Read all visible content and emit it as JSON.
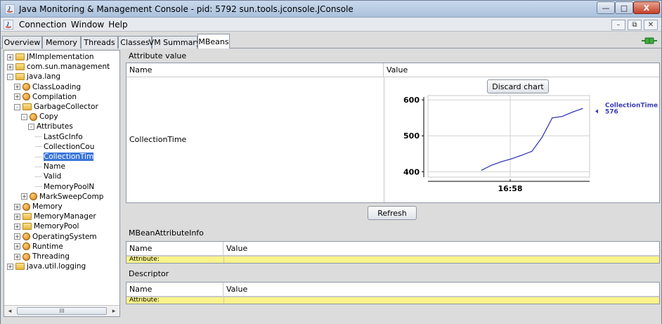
{
  "window": {
    "title": "Java Monitoring & Management Console - pid: 5792 sun.tools.jconsole.JConsole",
    "controls": {
      "minimize": "—",
      "maximize": "□",
      "close": "X"
    }
  },
  "menu": {
    "items": [
      "Connection",
      "Window",
      "Help"
    ],
    "mdi": {
      "minimize": "–",
      "restore": "⧉",
      "close": "✕"
    }
  },
  "tabs": [
    {
      "label": "Overview",
      "active": false
    },
    {
      "label": "Memory",
      "active": false
    },
    {
      "label": "Threads",
      "active": false
    },
    {
      "label": "Classes",
      "active": false
    },
    {
      "label": "VM Summary",
      "active": false
    },
    {
      "label": "MBeans",
      "active": true
    }
  ],
  "tree": {
    "nodes": [
      {
        "label": "JMImplementation",
        "icon": "folder",
        "expander": "+",
        "depth": 0
      },
      {
        "label": "com.sun.management",
        "icon": "folder",
        "expander": "+",
        "depth": 0
      },
      {
        "label": "java.lang",
        "icon": "folder",
        "expander": "-",
        "depth": 0
      },
      {
        "label": "ClassLoading",
        "icon": "bean",
        "expander": "+",
        "depth": 1
      },
      {
        "label": "Compilation",
        "icon": "bean",
        "expander": "+",
        "depth": 1
      },
      {
        "label": "GarbageCollector",
        "icon": "folder",
        "expander": "-",
        "depth": 1
      },
      {
        "label": "Copy",
        "icon": "bean",
        "expander": "-",
        "depth": 2
      },
      {
        "label": "Attributes",
        "icon": "none",
        "expander": "-",
        "depth": 3
      },
      {
        "label": "LastGcInfo",
        "icon": "none",
        "expander": "",
        "depth": 4
      },
      {
        "label": "CollectionCou",
        "icon": "none",
        "expander": "",
        "depth": 4
      },
      {
        "label": "CollectionTim",
        "icon": "none",
        "expander": "",
        "depth": 4,
        "selected": true
      },
      {
        "label": "Name",
        "icon": "none",
        "expander": "",
        "depth": 4
      },
      {
        "label": "Valid",
        "icon": "none",
        "expander": "",
        "depth": 4
      },
      {
        "label": "MemoryPoolN",
        "icon": "none",
        "expander": "",
        "depth": 4
      },
      {
        "label": "MarkSweepComp",
        "icon": "bean",
        "expander": "+",
        "depth": 2
      },
      {
        "label": "Memory",
        "icon": "bean",
        "expander": "+",
        "depth": 1
      },
      {
        "label": "MemoryManager",
        "icon": "folder",
        "expander": "+",
        "depth": 1
      },
      {
        "label": "MemoryPool",
        "icon": "folder",
        "expander": "+",
        "depth": 1
      },
      {
        "label": "OperatingSystem",
        "icon": "bean",
        "expander": "+",
        "depth": 1
      },
      {
        "label": "Runtime",
        "icon": "bean",
        "expander": "+",
        "depth": 1
      },
      {
        "label": "Threading",
        "icon": "bean",
        "expander": "+",
        "depth": 1
      },
      {
        "label": "java.util.logging",
        "icon": "folder",
        "expander": "+",
        "depth": 0
      }
    ],
    "hscroll": {
      "left": "◂",
      "right": "▸",
      "thumb": "III"
    }
  },
  "attribute_value": {
    "section_title": "Attribute value",
    "columns": [
      "Name",
      "Value"
    ],
    "row_name": "CollectionTime",
    "discard_label": "Discard chart"
  },
  "refresh_label": "Refresh",
  "mbean_attribute_info": {
    "section_title": "MBeanAttributeInfo",
    "columns": [
      "Name",
      "Value"
    ],
    "row_label": "Attribute:"
  },
  "descriptor": {
    "section_title": "Descriptor",
    "columns": [
      "Name",
      "Value"
    ],
    "row_label": "Attribute:"
  },
  "chart_data": {
    "type": "line",
    "title": "",
    "xlabel": "",
    "ylabel": "",
    "x_tick_label": "16:58",
    "y_ticks": [
      400,
      500,
      600
    ],
    "ylim": [
      385,
      612
    ],
    "grid": true,
    "series": [
      {
        "name": "CollectionTime",
        "color": "#3a3ab8",
        "latest_value_label": "576",
        "values": [
          404,
          418,
          428,
          436,
          446,
          457,
          496,
          550,
          554,
          566,
          576
        ]
      }
    ]
  }
}
